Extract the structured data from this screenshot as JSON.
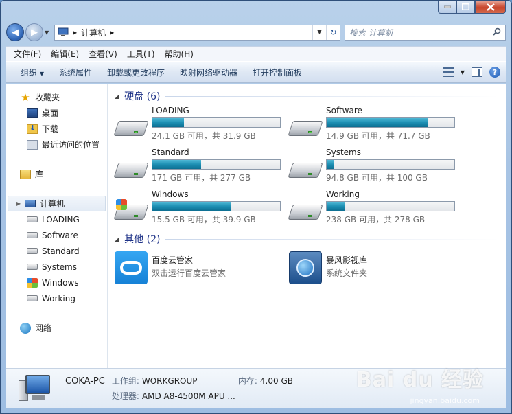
{
  "address": {
    "path": [
      "计算机"
    ],
    "search_placeholder": "搜索 计算机"
  },
  "menu": [
    "文件(F)",
    "编辑(E)",
    "查看(V)",
    "工具(T)",
    "帮助(H)"
  ],
  "toolbar": {
    "organize": "组织",
    "system_properties": "系统属性",
    "uninstall": "卸载或更改程序",
    "map_drive": "映射网络驱动器",
    "control_panel": "打开控制面板"
  },
  "nav": {
    "favorites": "收藏夹",
    "desktop": "桌面",
    "downloads": "下载",
    "recent": "最近访问的位置",
    "libraries": "库",
    "computer": "计算机",
    "drives": [
      "LOADING",
      "Software",
      "Standard",
      "Systems",
      "Windows",
      "Working"
    ],
    "network": "网络"
  },
  "groups": {
    "hdd_title": "硬盘 (6)",
    "other_title": "其他 (2)"
  },
  "drives": [
    {
      "name": "LOADING",
      "used_fraction": 0.245,
      "status": "24.1 GB 可用，共 31.9 GB"
    },
    {
      "name": "Software",
      "used_fraction": 0.792,
      "status": "14.9 GB 可用，共 71.7 GB"
    },
    {
      "name": "Standard",
      "used_fraction": 0.383,
      "status": "171 GB 可用，共 277 GB"
    },
    {
      "name": "Systems",
      "used_fraction": 0.052,
      "status": "94.8 GB 可用，共 100 GB"
    },
    {
      "name": "Windows",
      "used_fraction": 0.611,
      "status": "15.5 GB 可用，共 39.9 GB"
    },
    {
      "name": "Working",
      "used_fraction": 0.144,
      "status": "238 GB 可用，共 278 GB"
    }
  ],
  "others": [
    {
      "name": "百度云管家",
      "sub": "双击运行百度云管家"
    },
    {
      "name": "暴风影视库",
      "sub": "系统文件夹"
    }
  ],
  "details": {
    "pc_name": "COKA-PC",
    "workgroup_label": "工作组:",
    "workgroup": "WORKGROUP",
    "memory_label": "内存:",
    "memory": "4.00 GB",
    "cpu_label": "处理器:",
    "cpu": "AMD A8-4500M APU ..."
  },
  "watermark": {
    "text": "Bai du 经验",
    "sub": "jingyan.baidu.com"
  }
}
